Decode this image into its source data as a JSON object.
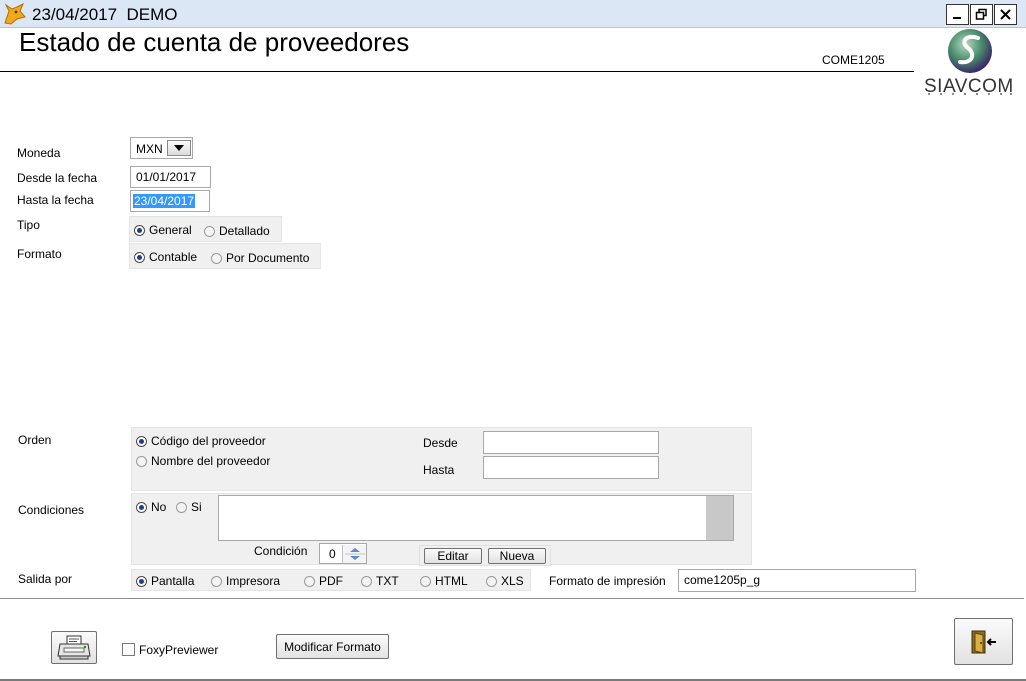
{
  "window": {
    "title": "23/04/2017  DEMO",
    "min_label": "minimize",
    "max_label": "restore",
    "close_label": "close"
  },
  "header": {
    "title": "Estado de cuenta de proveedores",
    "form_code": "COME1205",
    "logo_text": "SIAVCOM"
  },
  "form": {
    "moneda": {
      "label": "Moneda",
      "value": "MXN"
    },
    "desde_fecha": {
      "label": "Desde la fecha",
      "value": "01/01/2017"
    },
    "hasta_fecha": {
      "label": "Hasta la fecha",
      "value": "23/04/2017"
    },
    "tipo": {
      "label": "Tipo",
      "options": [
        "General",
        "Detallado"
      ],
      "selected": 0
    },
    "formato": {
      "label": "Formato",
      "options": [
        "Contable",
        "Por Documento"
      ],
      "selected": 0
    },
    "orden": {
      "label": "Orden",
      "options": [
        "Código del proveedor",
        "Nombre del proveedor"
      ],
      "selected": 0,
      "desde_label": "Desde",
      "hasta_label": "Hasta",
      "desde_value": "",
      "hasta_value": ""
    },
    "condiciones": {
      "label": "Condiciones",
      "options": [
        "No",
        "Si"
      ],
      "selected": 0,
      "condicion_label": "Condición",
      "condicion_value": "0",
      "editar_label": "Editar",
      "nueva_label": "Nueva"
    },
    "salida": {
      "label": "Salida por",
      "options": [
        "Pantalla",
        "Impresora",
        "PDF",
        "TXT",
        "HTML",
        "XLS"
      ],
      "selected": 0,
      "formato_impresion_label": "Formato de impresión",
      "formato_impresion_value": "come1205p_g"
    }
  },
  "footer": {
    "foxy_label": "FoxyPreviewer",
    "foxy_checked": false,
    "modificar_label": "Modificar Formato"
  },
  "colors": {
    "titlebar": "#dbe7f5",
    "selection": "#3399ff",
    "radio_dot": "#1c3f8a"
  }
}
